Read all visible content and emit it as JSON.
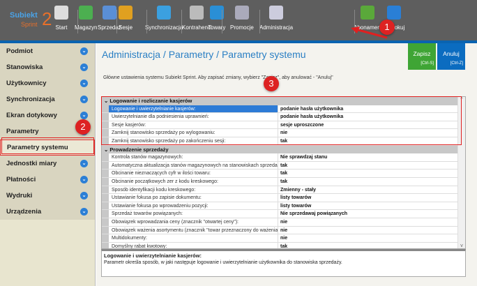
{
  "logo": {
    "line1": "Subiekt",
    "line2": "Sprint",
    "num": "2"
  },
  "toolbar": [
    {
      "label": "Start",
      "icon": "store-icon"
    },
    {
      "label": "Magazyn",
      "icon": "warehouse-icon"
    },
    {
      "label": "Sprzedaż",
      "icon": "sales-icon"
    },
    {
      "label": "Sesje",
      "icon": "sessions-icon"
    },
    {
      "label": "Synchronizacja",
      "icon": "sync-icon"
    },
    {
      "label": "Kontrahenci",
      "icon": "contractors-icon"
    },
    {
      "label": "Towary",
      "icon": "goods-icon"
    },
    {
      "label": "Promocje",
      "icon": "promo-tag-icon"
    },
    {
      "label": "Administracja",
      "icon": "tools-icon"
    },
    {
      "label": "Abonament",
      "icon": "shield-check-icon"
    },
    {
      "label": "Zablokuj",
      "icon": "lock-icon"
    }
  ],
  "sidebar": {
    "items": [
      "Podmiot",
      "Stanowiska",
      "Użytkownicy",
      "Synchronizacja",
      "Ekran dotykowy",
      "Parametry"
    ],
    "active": "Parametry systemu",
    "items2": [
      "Jednostki miary",
      "Płatności",
      "Wydruki",
      "Urządzenia"
    ]
  },
  "main": {
    "title": "Administracja / Parametry / Parametry systemu",
    "save": "Zapisz",
    "save_key": "[Ctrl-S]",
    "cancel": "Anuluj",
    "cancel_key": "[Ctrl-Z]",
    "description": "Główne ustawienia systemu Subiekt Sprint. Aby zapisać zmiany, wybierz \"Zapisz\", aby anulować - \"Anuluj\""
  },
  "groups": [
    {
      "title": "Logowanie i rozliczanie kasjerów",
      "rows": [
        [
          "Logowanie i uwierzytelnianie kasjerów:",
          "podanie hasła użytkownika"
        ],
        [
          "Uwierzytelnianie dla podniesienia uprawnień:",
          "podanie hasła użytkownika"
        ],
        [
          "Sesje kasjerów:",
          "sesje uproszczone"
        ],
        [
          "Zamknij stanowisko sprzedaży po wylogowaniu:",
          "nie"
        ],
        [
          "Zamknij stanowisko sprzedaży po zakończeniu sesji:",
          "tak"
        ]
      ]
    },
    {
      "title": "Prowadzenie sprzedaży",
      "rows": [
        [
          "Kontrola stanów magazynowych:",
          "Nie sprawdzaj stanu"
        ],
        [
          "Automatyczna aktualizacja stanów magazynowych na stanowiskach sprzedaży:",
          "tak"
        ],
        [
          "Obcinanie nieznaczących cyfr w ilości towaru:",
          "tak"
        ],
        [
          "Obcinanie początkowych zer z kodu kreskowego:",
          "tak"
        ],
        [
          "Sposób identyfikacji kodu kreskowego:",
          "Zmienny - stały"
        ],
        [
          "Ustawianie fokusa po zapisie dokumentu:",
          "listy towarów"
        ],
        [
          "Ustawianie fokusa po wprowadzeniu pozycji:",
          "listy towarów"
        ],
        [
          "Sprzedaż towarów powiązanych:",
          "Nie sprzedawaj powiązanych"
        ],
        [
          "Obowiązek wprowadzania ceny (znacznik \"otwartej ceny\"):",
          "nie"
        ],
        [
          "Obowiązek ważenia asortymentu (znacznik \"towar przeznaczony do ważenia\"):",
          "nie"
        ],
        [
          "Multidokumenty:",
          "nie"
        ],
        [
          "Domyślny rabat kwotowy:",
          "tak"
        ]
      ]
    }
  ],
  "help": {
    "title": "Logowanie i uwierzytelnianie kasjerów:",
    "text": "Parametr określa sposób, w jaki następuje logowanie i uwierzytelnianie użytkownika do stanowiska sprzedaży."
  },
  "annotations": [
    "1",
    "2",
    "3"
  ]
}
